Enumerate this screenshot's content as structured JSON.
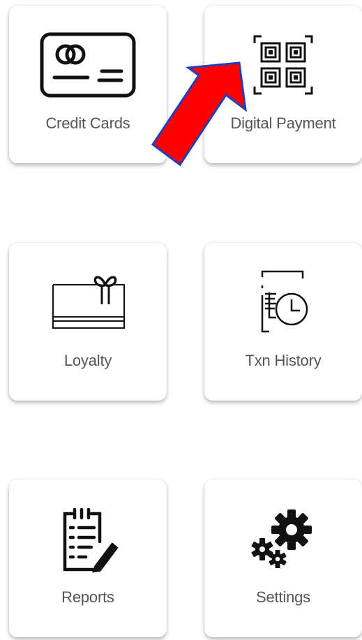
{
  "tiles": [
    {
      "id": "credit-cards",
      "label": "Credit Cards",
      "icon": "credit-card-icon"
    },
    {
      "id": "digital-payment",
      "label": "Digital Payment",
      "icon": "qr-code-icon"
    },
    {
      "id": "loyalty",
      "label": "Loyalty",
      "icon": "gift-card-icon"
    },
    {
      "id": "txn-history",
      "label": "Txn History",
      "icon": "transaction-history-icon"
    },
    {
      "id": "reports",
      "label": "Reports",
      "icon": "clipboard-report-icon"
    },
    {
      "id": "settings",
      "label": "Settings",
      "icon": "gears-icon"
    }
  ],
  "annotation": {
    "arrow_color": "#ff0000",
    "arrow_outline": "#1f3fbf",
    "points_to": "digital-payment",
    "icon": "arrow-annotation"
  }
}
